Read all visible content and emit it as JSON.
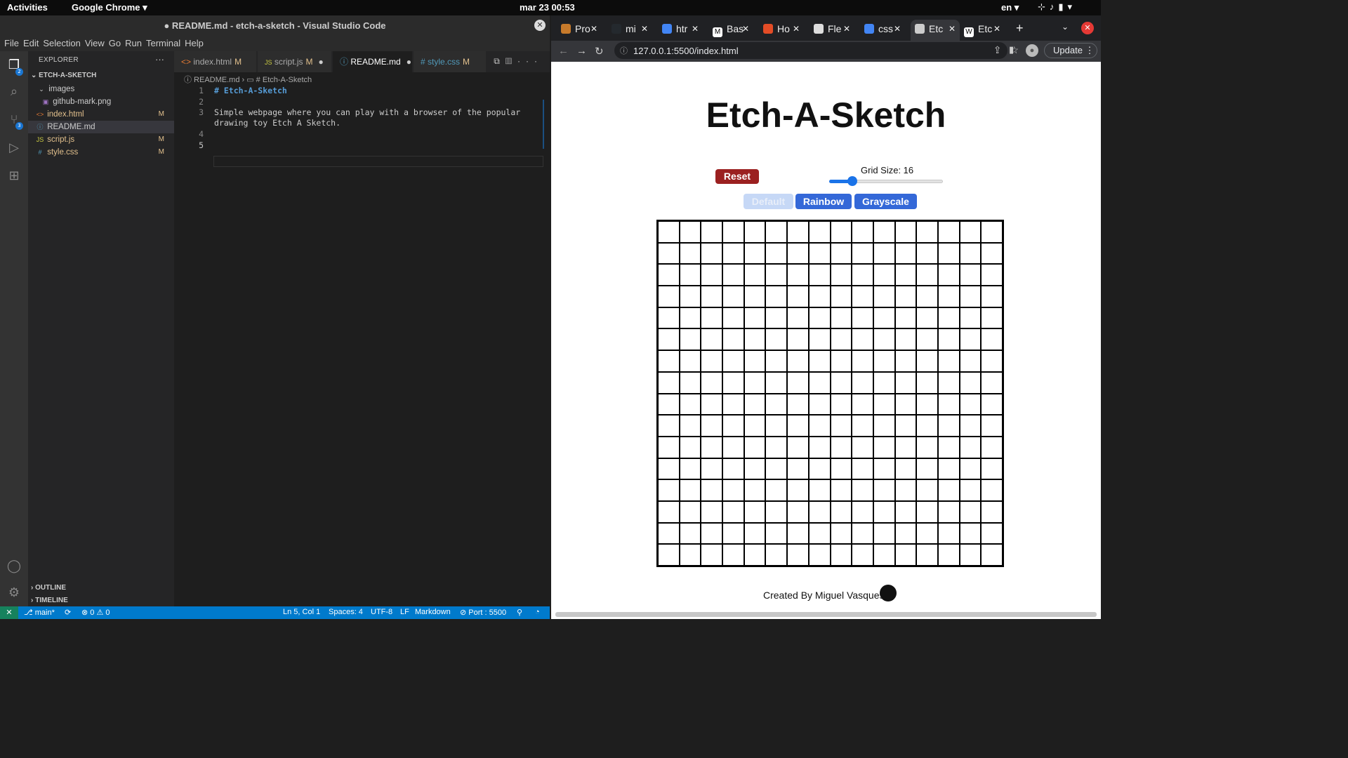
{
  "topbar": {
    "activities": "Activities",
    "app": "Google Chrome ▾",
    "clock": "mar 23  00:53",
    "lang": "en ▾"
  },
  "vscode": {
    "title": "● README.md - etch-a-sketch - Visual Studio Code",
    "menu": [
      "File",
      "Edit",
      "Selection",
      "View",
      "Go",
      "Run",
      "Terminal",
      "Help"
    ],
    "badges": {
      "explorer": "2",
      "scm": "3"
    },
    "explorer": {
      "header": "EXPLORER",
      "project": "ETCH-A-SKETCH",
      "items": [
        {
          "name": "images",
          "kind": "folder",
          "mod": ""
        },
        {
          "name": "github-mark.png",
          "kind": "png",
          "mod": ""
        },
        {
          "name": "index.html",
          "kind": "html",
          "mod": "M"
        },
        {
          "name": "README.md",
          "kind": "md",
          "mod": ""
        },
        {
          "name": "script.js",
          "kind": "js",
          "mod": "M"
        },
        {
          "name": "style.css",
          "kind": "css",
          "mod": "M"
        }
      ],
      "outline": "OUTLINE",
      "timeline": "TIMELINE"
    },
    "tabs": [
      {
        "label": "index.html",
        "mod": "M",
        "dot": "",
        "icon": "<>"
      },
      {
        "label": "script.js",
        "mod": "M",
        "dot": "●",
        "icon": "JS"
      },
      {
        "label": "README.md",
        "mod": "",
        "dot": "●",
        "icon": "ⓘ"
      },
      {
        "label": "style.css",
        "mod": "M",
        "dot": "",
        "icon": "#"
      }
    ],
    "breadcrumb": "ⓘ README.md  ›  ▭ # Etch-A-Sketch",
    "lines": [
      {
        "n": "1",
        "text": "# Etch-A-Sketch"
      },
      {
        "n": "2",
        "text": ""
      },
      {
        "n": "3",
        "text": "Simple webpage where you can play with a browser of the popular"
      },
      {
        "n": "",
        "text": "drawing toy Etch A Sketch."
      },
      {
        "n": "4",
        "text": ""
      },
      {
        "n": "5",
        "text": ""
      }
    ],
    "status": {
      "branch": "⎇ main*",
      "sync": "⟳",
      "problems": "⊗ 0 ⚠ 0",
      "position": "Ln 5, Col 1",
      "spaces": "Spaces: 4",
      "encoding": "UTF-8",
      "eol": "LF",
      "language": "Markdown",
      "port": "⊘ Port : 5500"
    }
  },
  "chrome": {
    "tabs": [
      "Pro",
      "mi",
      "htr",
      "Bas",
      "Ho",
      "Fle",
      "css",
      "Etc",
      "Etc"
    ],
    "url": "127.0.0.1:5500/index.html",
    "update": "Update"
  },
  "page": {
    "title": "Etch-A-Sketch",
    "reset": "Reset",
    "grid_label": "Grid Size: 16",
    "grid_size": 16,
    "slider": {
      "min": 1,
      "max": 100,
      "value": 16
    },
    "modes": [
      "Default",
      "Rainbow",
      "Grayscale"
    ],
    "active_mode": "Default",
    "credit": "Created By Miguel Vasques"
  }
}
